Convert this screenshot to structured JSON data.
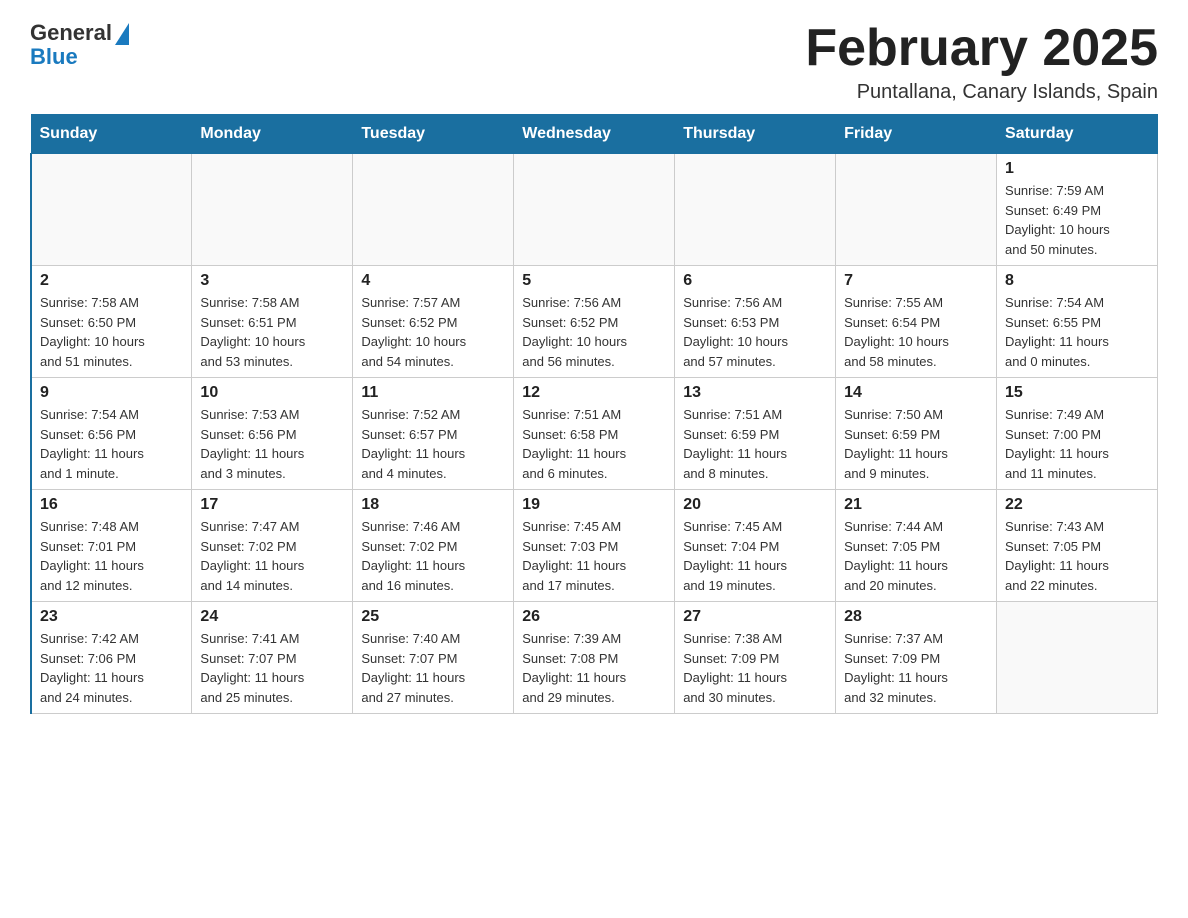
{
  "header": {
    "logo": {
      "general": "General",
      "blue": "Blue"
    },
    "title": "February 2025",
    "location": "Puntallana, Canary Islands, Spain"
  },
  "days_of_week": [
    "Sunday",
    "Monday",
    "Tuesday",
    "Wednesday",
    "Thursday",
    "Friday",
    "Saturday"
  ],
  "weeks": [
    {
      "cells": [
        {
          "day": "",
          "info": ""
        },
        {
          "day": "",
          "info": ""
        },
        {
          "day": "",
          "info": ""
        },
        {
          "day": "",
          "info": ""
        },
        {
          "day": "",
          "info": ""
        },
        {
          "day": "",
          "info": ""
        },
        {
          "day": "1",
          "info": "Sunrise: 7:59 AM\nSunset: 6:49 PM\nDaylight: 10 hours\nand 50 minutes."
        }
      ]
    },
    {
      "cells": [
        {
          "day": "2",
          "info": "Sunrise: 7:58 AM\nSunset: 6:50 PM\nDaylight: 10 hours\nand 51 minutes."
        },
        {
          "day": "3",
          "info": "Sunrise: 7:58 AM\nSunset: 6:51 PM\nDaylight: 10 hours\nand 53 minutes."
        },
        {
          "day": "4",
          "info": "Sunrise: 7:57 AM\nSunset: 6:52 PM\nDaylight: 10 hours\nand 54 minutes."
        },
        {
          "day": "5",
          "info": "Sunrise: 7:56 AM\nSunset: 6:52 PM\nDaylight: 10 hours\nand 56 minutes."
        },
        {
          "day": "6",
          "info": "Sunrise: 7:56 AM\nSunset: 6:53 PM\nDaylight: 10 hours\nand 57 minutes."
        },
        {
          "day": "7",
          "info": "Sunrise: 7:55 AM\nSunset: 6:54 PM\nDaylight: 10 hours\nand 58 minutes."
        },
        {
          "day": "8",
          "info": "Sunrise: 7:54 AM\nSunset: 6:55 PM\nDaylight: 11 hours\nand 0 minutes."
        }
      ]
    },
    {
      "cells": [
        {
          "day": "9",
          "info": "Sunrise: 7:54 AM\nSunset: 6:56 PM\nDaylight: 11 hours\nand 1 minute."
        },
        {
          "day": "10",
          "info": "Sunrise: 7:53 AM\nSunset: 6:56 PM\nDaylight: 11 hours\nand 3 minutes."
        },
        {
          "day": "11",
          "info": "Sunrise: 7:52 AM\nSunset: 6:57 PM\nDaylight: 11 hours\nand 4 minutes."
        },
        {
          "day": "12",
          "info": "Sunrise: 7:51 AM\nSunset: 6:58 PM\nDaylight: 11 hours\nand 6 minutes."
        },
        {
          "day": "13",
          "info": "Sunrise: 7:51 AM\nSunset: 6:59 PM\nDaylight: 11 hours\nand 8 minutes."
        },
        {
          "day": "14",
          "info": "Sunrise: 7:50 AM\nSunset: 6:59 PM\nDaylight: 11 hours\nand 9 minutes."
        },
        {
          "day": "15",
          "info": "Sunrise: 7:49 AM\nSunset: 7:00 PM\nDaylight: 11 hours\nand 11 minutes."
        }
      ]
    },
    {
      "cells": [
        {
          "day": "16",
          "info": "Sunrise: 7:48 AM\nSunset: 7:01 PM\nDaylight: 11 hours\nand 12 minutes."
        },
        {
          "day": "17",
          "info": "Sunrise: 7:47 AM\nSunset: 7:02 PM\nDaylight: 11 hours\nand 14 minutes."
        },
        {
          "day": "18",
          "info": "Sunrise: 7:46 AM\nSunset: 7:02 PM\nDaylight: 11 hours\nand 16 minutes."
        },
        {
          "day": "19",
          "info": "Sunrise: 7:45 AM\nSunset: 7:03 PM\nDaylight: 11 hours\nand 17 minutes."
        },
        {
          "day": "20",
          "info": "Sunrise: 7:45 AM\nSunset: 7:04 PM\nDaylight: 11 hours\nand 19 minutes."
        },
        {
          "day": "21",
          "info": "Sunrise: 7:44 AM\nSunset: 7:05 PM\nDaylight: 11 hours\nand 20 minutes."
        },
        {
          "day": "22",
          "info": "Sunrise: 7:43 AM\nSunset: 7:05 PM\nDaylight: 11 hours\nand 22 minutes."
        }
      ]
    },
    {
      "cells": [
        {
          "day": "23",
          "info": "Sunrise: 7:42 AM\nSunset: 7:06 PM\nDaylight: 11 hours\nand 24 minutes."
        },
        {
          "day": "24",
          "info": "Sunrise: 7:41 AM\nSunset: 7:07 PM\nDaylight: 11 hours\nand 25 minutes."
        },
        {
          "day": "25",
          "info": "Sunrise: 7:40 AM\nSunset: 7:07 PM\nDaylight: 11 hours\nand 27 minutes."
        },
        {
          "day": "26",
          "info": "Sunrise: 7:39 AM\nSunset: 7:08 PM\nDaylight: 11 hours\nand 29 minutes."
        },
        {
          "day": "27",
          "info": "Sunrise: 7:38 AM\nSunset: 7:09 PM\nDaylight: 11 hours\nand 30 minutes."
        },
        {
          "day": "28",
          "info": "Sunrise: 7:37 AM\nSunset: 7:09 PM\nDaylight: 11 hours\nand 32 minutes."
        },
        {
          "day": "",
          "info": ""
        }
      ]
    }
  ]
}
